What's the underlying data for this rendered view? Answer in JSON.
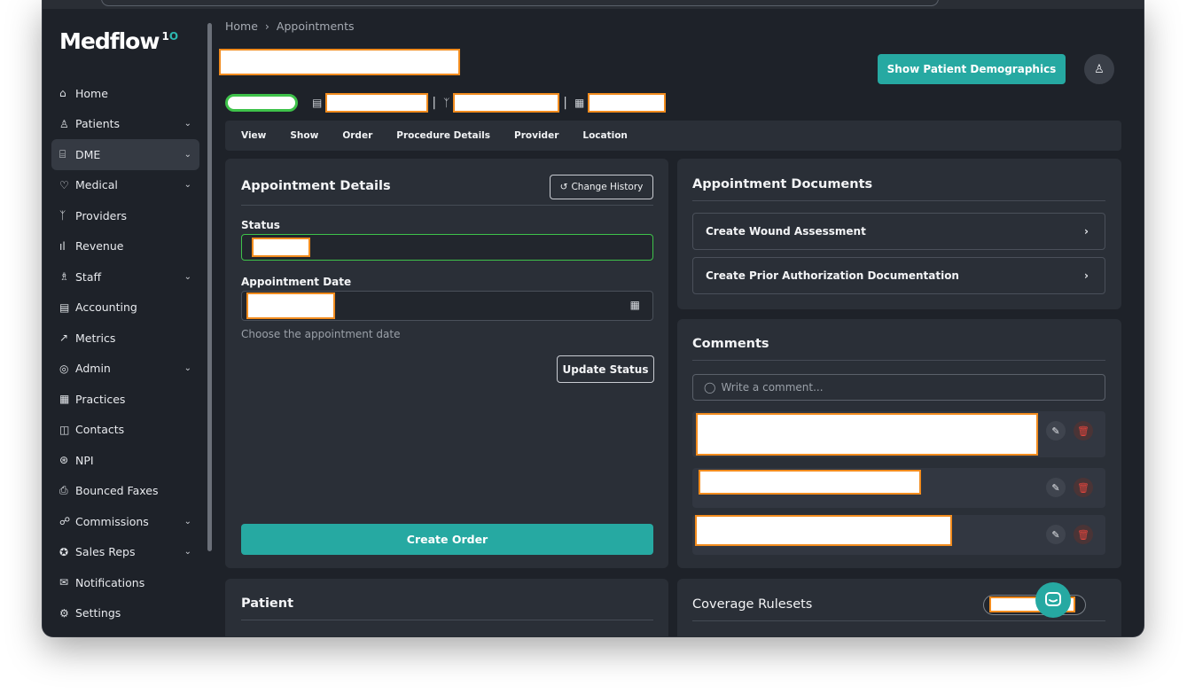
{
  "app": {
    "logo_text": "Medflow",
    "logo_sup_a": "1",
    "logo_sup_b": "O"
  },
  "sidebar": {
    "items": [
      {
        "label": "Home",
        "icon": "home-icon",
        "glyph": "⌂",
        "chevron": false,
        "active": false
      },
      {
        "label": "Patients",
        "icon": "user-icon",
        "glyph": "♙",
        "chevron": true,
        "active": false
      },
      {
        "label": "DME",
        "icon": "building-icon",
        "glyph": "⌸",
        "chevron": true,
        "active": true
      },
      {
        "label": "Medical",
        "icon": "heart-pulse-icon",
        "glyph": "♡",
        "chevron": true,
        "active": false
      },
      {
        "label": "Providers",
        "icon": "stethoscope-icon",
        "glyph": "ᛉ",
        "chevron": false,
        "active": false
      },
      {
        "label": "Revenue",
        "icon": "bar-chart-icon",
        "glyph": "ıl",
        "chevron": false,
        "active": false
      },
      {
        "label": "Staff",
        "icon": "users-icon",
        "glyph": "♗",
        "chevron": true,
        "active": false
      },
      {
        "label": "Accounting",
        "icon": "file-text-icon",
        "glyph": "▤",
        "chevron": false,
        "active": false
      },
      {
        "label": "Metrics",
        "icon": "trending-up-icon",
        "glyph": "↗",
        "chevron": false,
        "active": false
      },
      {
        "label": "Admin",
        "icon": "shield-icon",
        "glyph": "◎",
        "chevron": true,
        "active": false
      },
      {
        "label": "Practices",
        "icon": "calculator-icon",
        "glyph": "▦",
        "chevron": false,
        "active": false
      },
      {
        "label": "Contacts",
        "icon": "book-open-icon",
        "glyph": "◫",
        "chevron": false,
        "active": false
      },
      {
        "label": "NPI",
        "icon": "fingerprint-icon",
        "glyph": "⊛",
        "chevron": false,
        "active": false
      },
      {
        "label": "Bounced Faxes",
        "icon": "printer-icon",
        "glyph": "⎙",
        "chevron": false,
        "active": false
      },
      {
        "label": "Commissions",
        "icon": "handshake-icon",
        "glyph": "☍",
        "chevron": true,
        "active": false
      },
      {
        "label": "Sales Reps",
        "icon": "badge-icon",
        "glyph": "✪",
        "chevron": true,
        "active": false
      },
      {
        "label": "Notifications",
        "icon": "mail-icon",
        "glyph": "✉",
        "chevron": false,
        "active": false
      },
      {
        "label": "Settings",
        "icon": "gear-icon",
        "glyph": "⚙",
        "chevron": false,
        "active": false
      }
    ]
  },
  "breadcrumb": {
    "home": "Home",
    "sep": "›",
    "current": "Appointments"
  },
  "header": {
    "demographics_button": "Show Patient Demographics"
  },
  "tabs": [
    "View",
    "Show",
    "Order",
    "Procedure Details",
    "Provider",
    "Location"
  ],
  "appointment_details": {
    "title": "Appointment Details",
    "change_history": "Change History",
    "status_label": "Status",
    "date_label": "Appointment Date",
    "date_hint": "Choose the appointment date",
    "update_button": "Update Status",
    "create_order_button": "Create Order"
  },
  "documents": {
    "title": "Appointment Documents",
    "items": [
      "Create Wound Assessment",
      "Create Prior Authorization Documentation"
    ]
  },
  "comments": {
    "title": "Comments",
    "placeholder": "Write a comment..."
  },
  "patient": {
    "title": "Patient"
  },
  "coverage": {
    "title": "Coverage Rulesets"
  },
  "colors": {
    "accent": "#26a9a2",
    "redaction_border": "#f28c1e",
    "status_green": "#3ec24a",
    "delete_red": "#e0453d"
  }
}
